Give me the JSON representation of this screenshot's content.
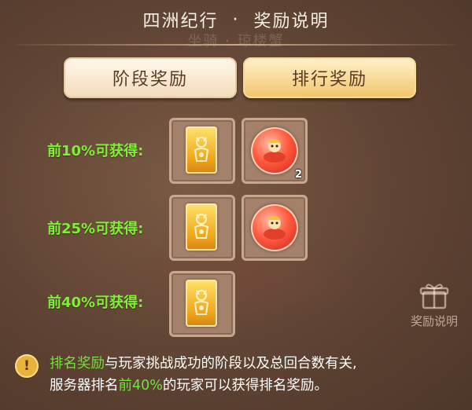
{
  "header": {
    "title_left": "四洲纪行",
    "separator": "·",
    "title_right": "奖励说明",
    "watermark": "坐骑 · 琼楼蟹"
  },
  "tabs": [
    {
      "label": "阶段奖励",
      "active": false
    },
    {
      "label": "排行奖励",
      "active": true
    }
  ],
  "rewards": [
    {
      "label": "前10%可获得:",
      "items": [
        {
          "icon": "gold-card-icon",
          "count": ""
        },
        {
          "icon": "red-orb-mount-icon",
          "count": "2"
        }
      ]
    },
    {
      "label": "前25%可获得:",
      "items": [
        {
          "icon": "gold-card-icon",
          "count": ""
        },
        {
          "icon": "red-orb-mount-icon",
          "count": ""
        }
      ]
    },
    {
      "label": "前40%可获得:",
      "items": [
        {
          "icon": "gold-card-icon",
          "count": ""
        }
      ]
    }
  ],
  "side_button": {
    "label": "奖励说明",
    "icon": "gift-icon"
  },
  "notice": {
    "hl1": "排名奖励",
    "t1": "与玩家挑战成功的阶段以及总回合数有关,",
    "t2": "服务器排名",
    "hl2": "前40%",
    "t3": "的玩家可以获得排名奖励。"
  },
  "colors": {
    "highlight_green": "#6fe33b",
    "label_green": "#7fef38",
    "gold": "#f0a51c"
  }
}
